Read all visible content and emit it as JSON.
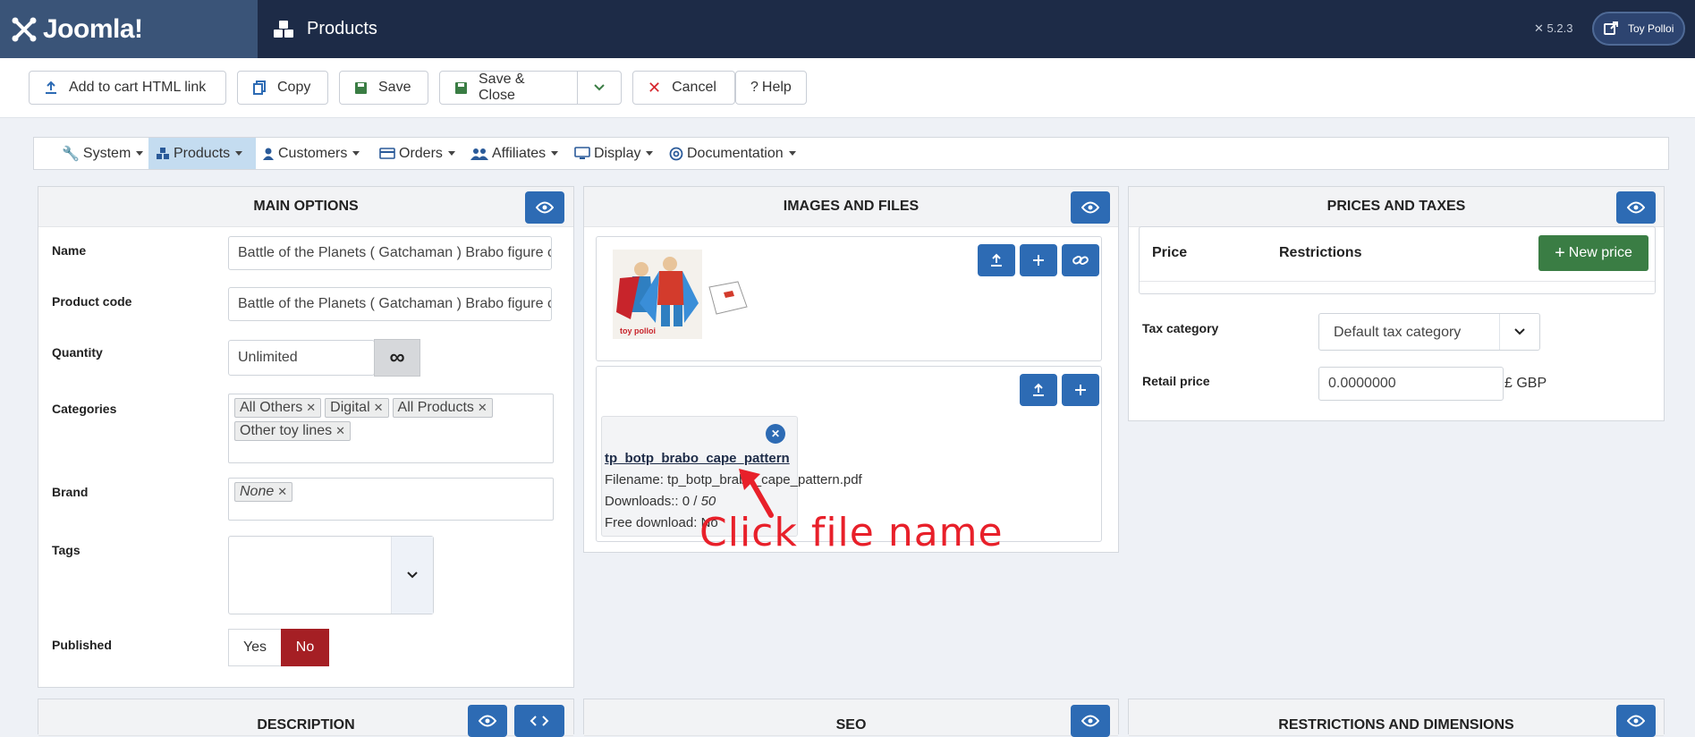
{
  "header": {
    "logo_text": "Joomla!",
    "title": "Products",
    "version": "5.2.3",
    "user": "Toy Polloi"
  },
  "toolbar": {
    "add_to_cart": "Add to cart HTML link",
    "copy": "Copy",
    "save": "Save",
    "save_close": "Save & Close",
    "cancel": "Cancel",
    "help": "Help"
  },
  "menu": {
    "items": [
      "System",
      "Products",
      "Customers",
      "Orders",
      "Affiliates",
      "Display",
      "Documentation"
    ]
  },
  "main_options": {
    "title": "MAIN OPTIONS",
    "name_label": "Name",
    "name_value": "Battle of the Planets ( Gatchaman ) Brabo figure cape pattern",
    "code_label": "Product code",
    "code_value": "Battle of the Planets ( Gatchaman ) Brabo figure cape pattern",
    "quantity_label": "Quantity",
    "quantity_value": "Unlimited",
    "categories_label": "Categories",
    "categories": [
      "All Others",
      "Digital",
      "All Products",
      "Other toy lines"
    ],
    "brand_label": "Brand",
    "brand_value": "None",
    "tags_label": "Tags",
    "published_label": "Published",
    "published_yes": "Yes",
    "published_no": "No"
  },
  "images_files": {
    "title": "IMAGES AND FILES",
    "image_caption": "toy polloi",
    "file": {
      "title": "tp_botp_brabo_cape_pattern",
      "filename": "Filename: tp_botp_brabo_cape_pattern.pdf",
      "downloads_label": "Downloads:: 0 / ",
      "downloads_max": "50",
      "free_download": "Free download: No"
    }
  },
  "prices": {
    "title": "PRICES AND TAXES",
    "col_price": "Price",
    "col_restrictions": "Restrictions",
    "new_price": "New price",
    "tax_label": "Tax category",
    "tax_value": "Default tax category",
    "retail_label": "Retail price",
    "retail_value": "0.0000000",
    "currency": "£ GBP"
  },
  "bottom": {
    "description": "DESCRIPTION",
    "seo": "SEO",
    "restrictions": "RESTRICTIONS AND DIMENSIONS"
  },
  "annotation": "Click file name",
  "colors": {
    "header_bg": "#1d2b47",
    "primary": "#2d6bb4",
    "success": "#3a7d44",
    "danger": "#a51f24",
    "annotation": "#e8202a"
  }
}
